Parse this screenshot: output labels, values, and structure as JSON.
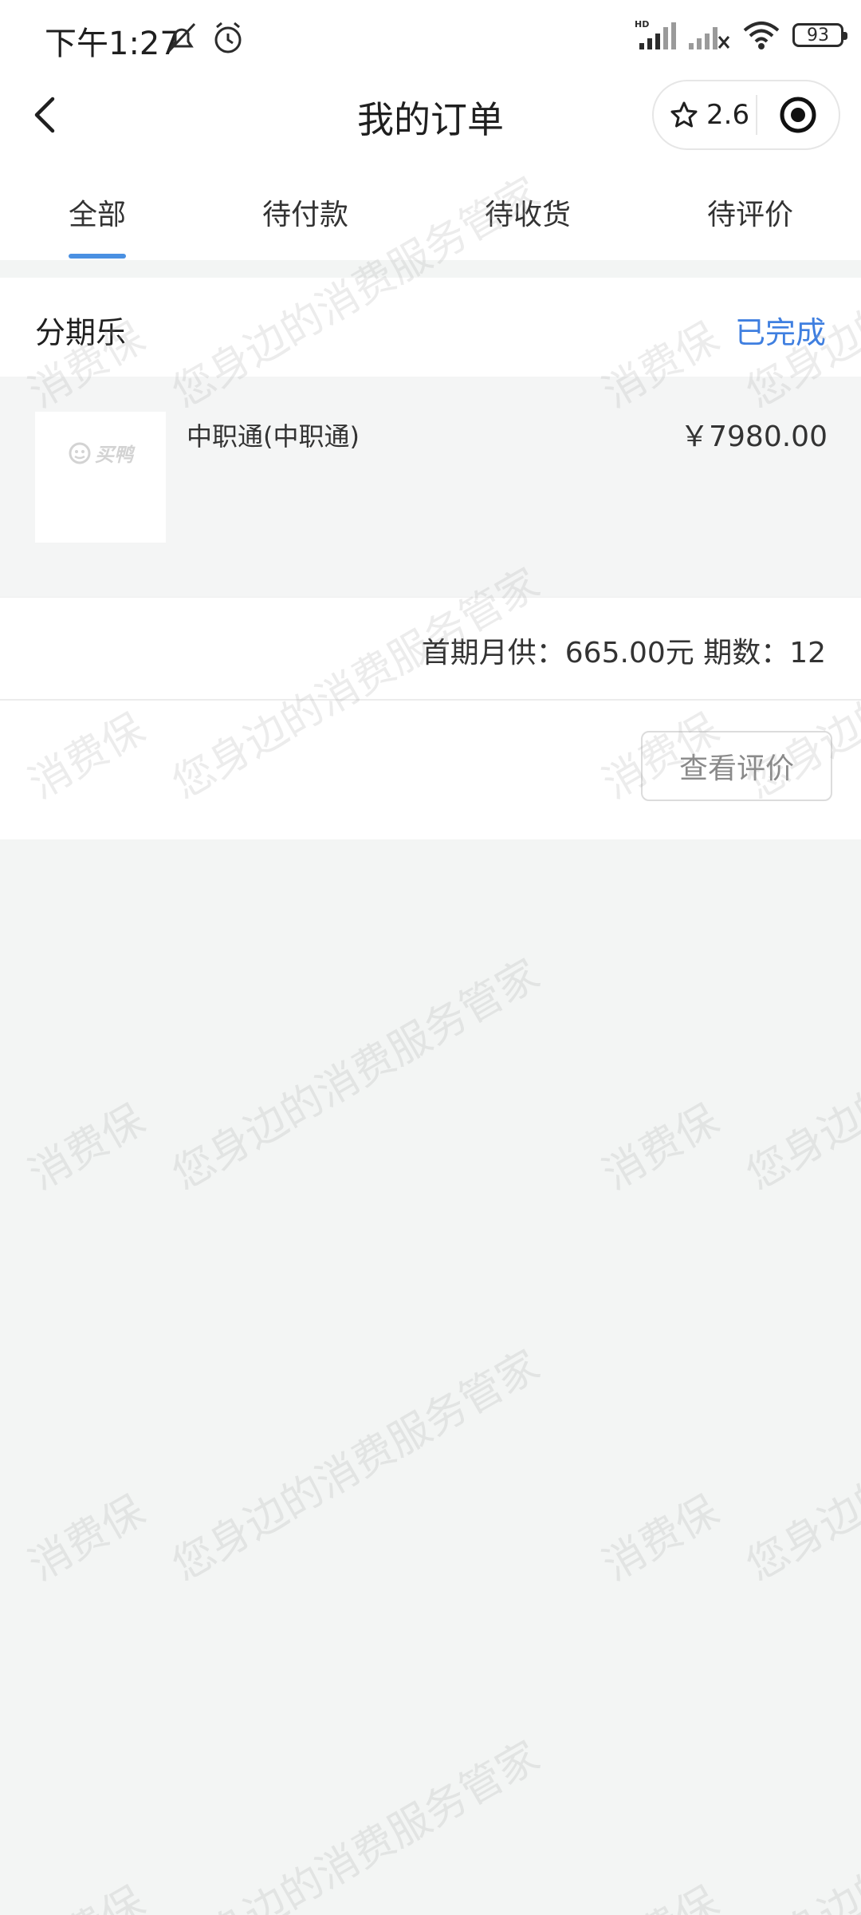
{
  "status_bar": {
    "time": "下午1:27",
    "battery": "93"
  },
  "header": {
    "title": "我的订单",
    "capsule_score": "2.6"
  },
  "tabs": [
    {
      "label": "全部",
      "active": true
    },
    {
      "label": "待付款",
      "active": false
    },
    {
      "label": "待收货",
      "active": false
    },
    {
      "label": "待评价",
      "active": false
    }
  ],
  "order": {
    "shop": "分期乐",
    "status": "已完成",
    "item_logo_text": "买鸭",
    "item_name": "中职通(中职通)",
    "item_price": "￥7980.00",
    "installment_text": "首期月供：665.00元 期数：12",
    "review_button": "查看评价"
  },
  "watermark": {
    "line1": "消费保",
    "line2": "您身边的消费服务管家"
  },
  "colors": {
    "accent": "#4a90e2",
    "status": "#3f7fe0",
    "background": "#f3f5f4"
  },
  "icons": {
    "back": "chevron-left-icon",
    "star": "star-icon",
    "record": "target-icon"
  }
}
